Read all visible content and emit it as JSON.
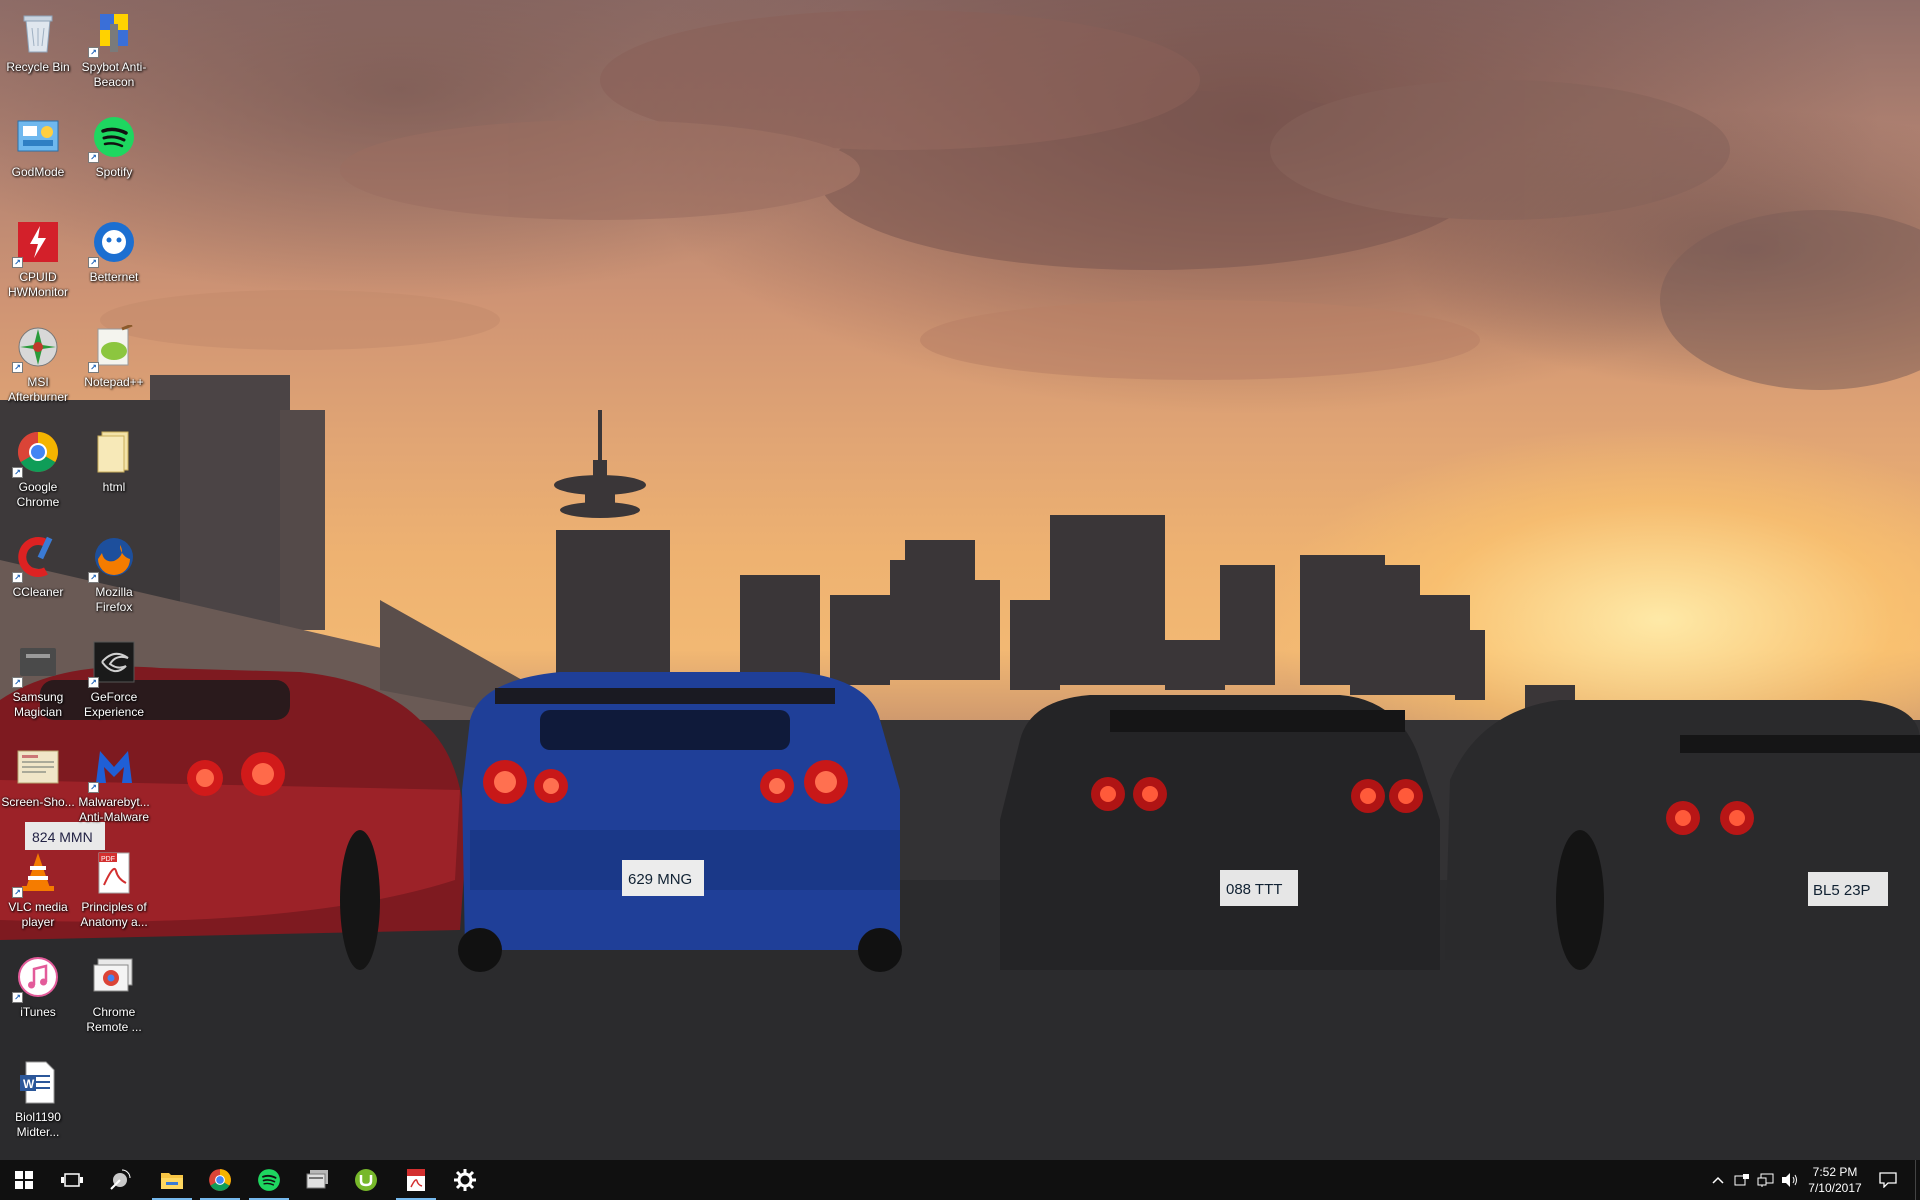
{
  "desktop": {
    "wallpaper": {
      "plates": [
        "824 MMN",
        "629 MNG",
        "088 TTT",
        "BL5 23P"
      ]
    },
    "icons": [
      {
        "label": "Recycle Bin",
        "icon": "recycle-bin-icon"
      },
      {
        "label": "Spybot Anti-Beacon",
        "icon": "spybot-icon"
      },
      {
        "label": "GodMode",
        "icon": "control-panel-icon"
      },
      {
        "label": "Spotify",
        "icon": "spotify-icon"
      },
      {
        "label": "CPUID HWMonitor",
        "icon": "hwmonitor-icon"
      },
      {
        "label": "Betternet",
        "icon": "betternet-icon"
      },
      {
        "label": "MSI Afterburner",
        "icon": "afterburner-icon"
      },
      {
        "label": "Notepad++",
        "icon": "notepad-plus-plus-icon"
      },
      {
        "label": "Google Chrome",
        "icon": "chrome-icon"
      },
      {
        "label": "html",
        "icon": "folder-icon"
      },
      {
        "label": "CCleaner",
        "icon": "ccleaner-icon"
      },
      {
        "label": "Mozilla Firefox",
        "icon": "firefox-icon"
      },
      {
        "label": "Samsung Magician",
        "icon": "samsung-magician-icon"
      },
      {
        "label": "GeForce Experience",
        "icon": "geforce-icon"
      },
      {
        "label": "Screen-Sho...",
        "icon": "screenshot-file-icon"
      },
      {
        "label": "Malwarebyt... Anti-Malware",
        "icon": "malwarebytes-icon"
      },
      {
        "label": "VLC media player",
        "icon": "vlc-icon"
      },
      {
        "label": "Principles of Anatomy a...",
        "icon": "pdf-icon"
      },
      {
        "label": "iTunes",
        "icon": "itunes-icon"
      },
      {
        "label": "Chrome Remote ...",
        "icon": "chrome-remote-desktop-icon"
      },
      {
        "label": "Biol1190 Midter...",
        "icon": "word-document-icon"
      }
    ]
  },
  "taskbar": {
    "buttons": [
      {
        "name": "start",
        "icon": "windows-logo-icon"
      },
      {
        "name": "task-view",
        "icon": "task-view-icon"
      },
      {
        "name": "pinned-1",
        "icon": "satellite-app-icon"
      },
      {
        "name": "file-explorer",
        "icon": "folder-icon"
      },
      {
        "name": "chrome",
        "icon": "chrome-icon"
      },
      {
        "name": "spotify",
        "icon": "spotify-icon"
      },
      {
        "name": "pinned-2",
        "icon": "app-window-icon"
      },
      {
        "name": "utorrent",
        "icon": "utorrent-icon"
      },
      {
        "name": "acrobat",
        "icon": "pdf-icon"
      },
      {
        "name": "settings",
        "icon": "gear-icon"
      }
    ],
    "tray": {
      "time": "7:52 PM",
      "date": "7/10/2017"
    }
  }
}
